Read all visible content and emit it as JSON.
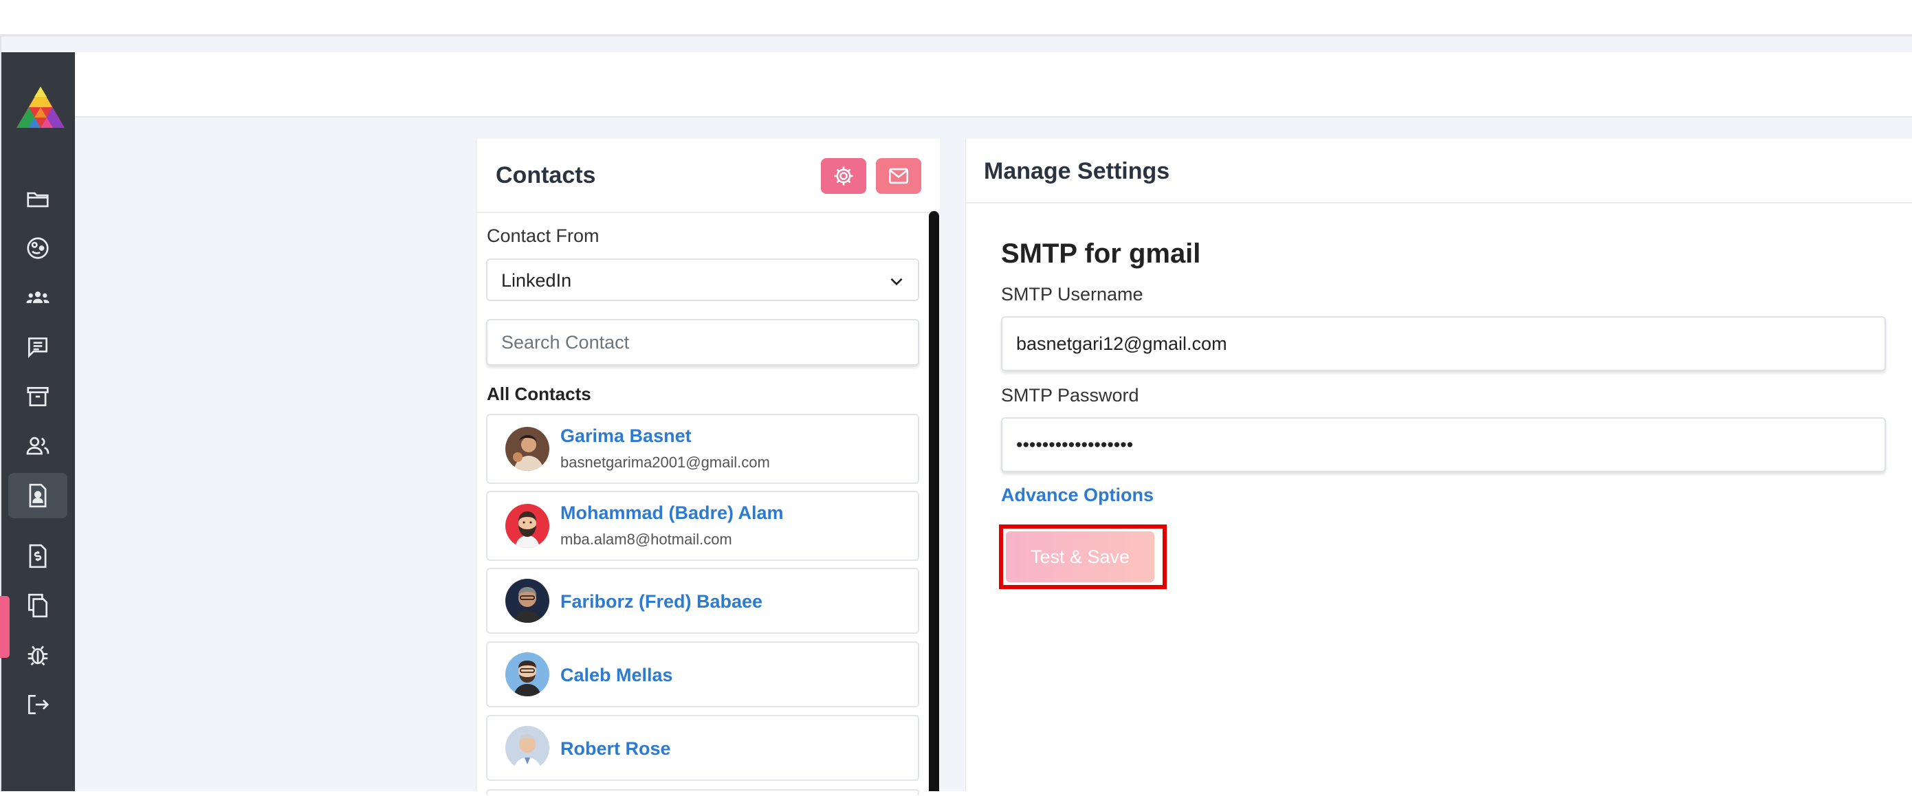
{
  "contacts_panel": {
    "title": "Contacts",
    "settings_button_color": "#ef6c8c",
    "mail_button_color": "#f27a8a",
    "contact_from_label": "Contact From",
    "contact_from_value": "LinkedIn",
    "search_placeholder": "Search Contact",
    "all_contacts_label": "All Contacts",
    "contacts": [
      {
        "name": "Garima Basnet",
        "email": "basnetgarima2001@gmail.com"
      },
      {
        "name": "Mohammad (Badre) Alam",
        "email": "mba.alam8@hotmail.com"
      },
      {
        "name": "Fariborz (Fred) Babaee"
      },
      {
        "name": "Caleb Mellas"
      },
      {
        "name": "Robert Rose"
      }
    ]
  },
  "settings_panel": {
    "title": "Manage Settings",
    "section_title": "SMTP for gmail",
    "username_label": "SMTP Username",
    "username_value": "basnetgari12@gmail.com",
    "password_label": "SMTP Password",
    "password_value": "••••••••••••••••••",
    "advance_options_label": "Advance Options",
    "test_save_label": "Test & Save"
  },
  "sidebar": {
    "items": [
      "folder-icon",
      "palette-icon",
      "team-icon",
      "chat-icon",
      "archive-icon",
      "users-icon",
      "contact-card-icon",
      "invoice-icon",
      "copy-icon",
      "bug-icon",
      "logout-icon"
    ],
    "active_item": "contact-card-icon"
  },
  "colors": {
    "sidebar_bg": "#343a40",
    "accent_pink": "#ef5f87",
    "link_blue": "#2c7bd0",
    "highlight_red": "#e00000"
  }
}
